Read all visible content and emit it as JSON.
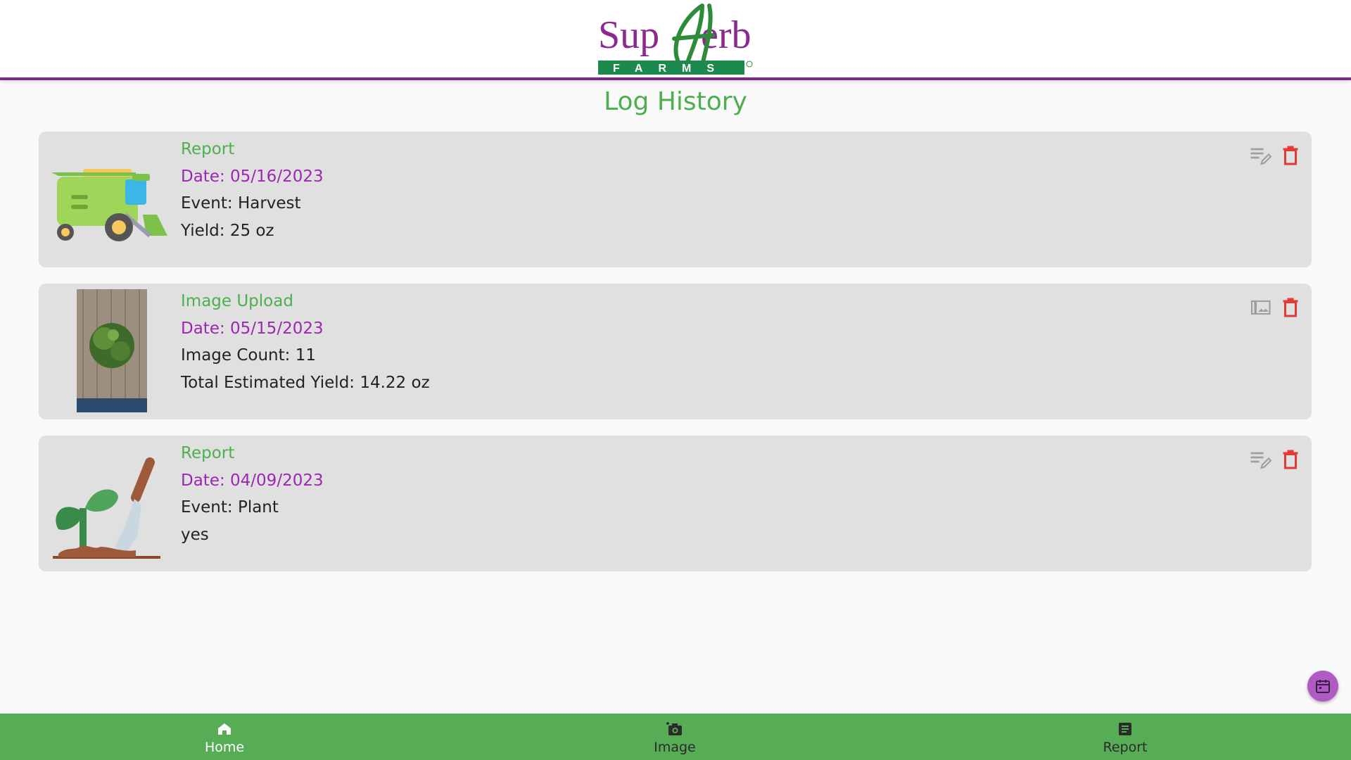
{
  "header": {
    "logo_text": "SupHerb",
    "logo_subtext": "FARMS",
    "logo_icon": "supherb-farms-logo"
  },
  "page": {
    "title": "Log History"
  },
  "logs": [
    {
      "type": "Report",
      "date": "Date: 05/16/2023",
      "line1": "Event: Harvest",
      "line2": "Yield: 25 oz",
      "thumbnail": "combine-harvester-icon",
      "action_icon": "edit-note-icon"
    },
    {
      "type": "Image Upload",
      "date": "Date: 05/15/2023",
      "line1": "Image Count: 11",
      "line2": "Total Estimated Yield: 14.22 oz",
      "thumbnail": "herb-photo",
      "action_icon": "photo-library-icon"
    },
    {
      "type": "Report",
      "date": "Date: 04/09/2023",
      "line1": "Event: Plant",
      "line2": "yes",
      "thumbnail": "seedling-shovel-icon",
      "action_icon": "edit-note-icon"
    }
  ],
  "fab": {
    "icon": "calendar-icon"
  },
  "nav": {
    "items": [
      {
        "label": "Home",
        "icon": "home-icon",
        "active": true
      },
      {
        "label": "Image",
        "icon": "add-camera-icon",
        "active": false
      },
      {
        "label": "Report",
        "icon": "article-icon",
        "active": false
      }
    ]
  },
  "colors": {
    "brand_green": "#4caf50",
    "brand_purple": "#7b2a82",
    "date_purple": "#9c27b0",
    "delete_red": "#e53935",
    "nav_green": "#57ad55",
    "card_bg": "#e0e0e0"
  }
}
